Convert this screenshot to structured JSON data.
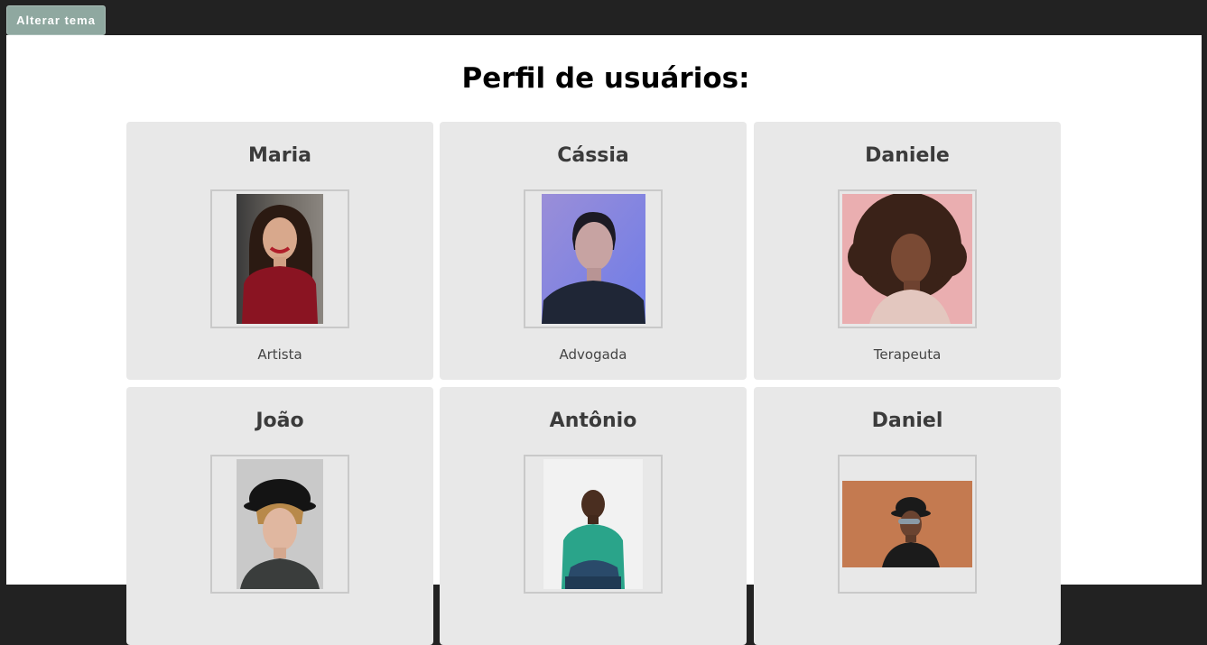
{
  "header": {
    "theme_button": "Alterar tema"
  },
  "title": "Perfil de usuários:",
  "profiles": [
    {
      "name": "Maria",
      "role": "Artista"
    },
    {
      "name": "Cássia",
      "role": "Advogada"
    },
    {
      "name": "Daniele",
      "role": "Terapeuta"
    },
    {
      "name": "João",
      "role": ""
    },
    {
      "name": "Antônio",
      "role": ""
    },
    {
      "name": "Daniel",
      "role": ""
    }
  ]
}
